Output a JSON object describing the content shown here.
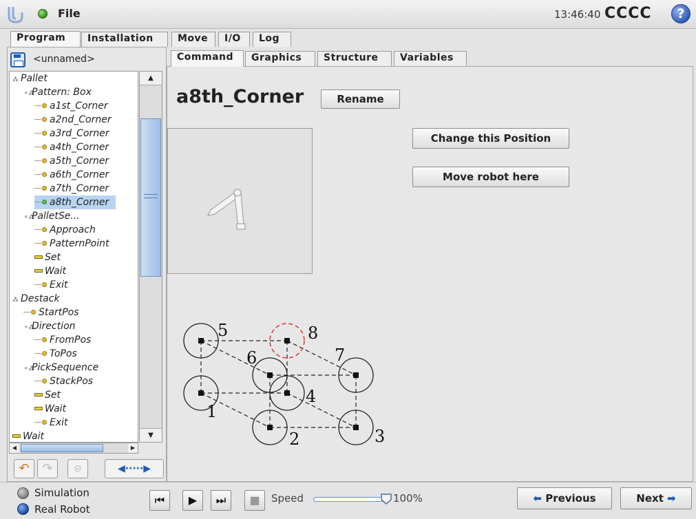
{
  "header": {
    "file_label": "File",
    "clock": "13:46:40",
    "robot_name": "CCCC",
    "help_label": "?"
  },
  "main_tabs": [
    "Program",
    "Installation",
    "Move",
    "I/O",
    "Log"
  ],
  "left": {
    "program_name": "<unnamed>",
    "tree": [
      {
        "label": "Pallet",
        "kind": "group",
        "indent": 0
      },
      {
        "label": "Pattern: Box",
        "kind": "group-expand",
        "indent": 1
      },
      {
        "label": "a1st_Corner",
        "kind": "waypoint",
        "indent": 2
      },
      {
        "label": "a2nd_Corner",
        "kind": "waypoint",
        "indent": 2
      },
      {
        "label": "a3rd_Corner",
        "kind": "waypoint",
        "indent": 2
      },
      {
        "label": "a4th_Corner",
        "kind": "waypoint",
        "indent": 2
      },
      {
        "label": "a5th_Corner",
        "kind": "waypoint",
        "indent": 2
      },
      {
        "label": "a6th_Corner",
        "kind": "waypoint",
        "indent": 2
      },
      {
        "label": "a7th_Corner",
        "kind": "waypoint",
        "indent": 2
      },
      {
        "label": "a8th_Corner",
        "kind": "waypoint-selected",
        "indent": 2
      },
      {
        "label": "PalletSe...",
        "kind": "group-expand",
        "indent": 1
      },
      {
        "label": "Approach",
        "kind": "waypoint",
        "indent": 2
      },
      {
        "label": "PatternPoint",
        "kind": "waypoint",
        "indent": 2
      },
      {
        "label": "Set",
        "kind": "action",
        "indent": 2
      },
      {
        "label": "Wait",
        "kind": "action",
        "indent": 2
      },
      {
        "label": "Exit",
        "kind": "waypoint",
        "indent": 2
      },
      {
        "label": "Destack",
        "kind": "group",
        "indent": 0
      },
      {
        "label": "StartPos",
        "kind": "waypoint",
        "indent": 1
      },
      {
        "label": "Direction",
        "kind": "group-expand",
        "indent": 1
      },
      {
        "label": "FromPos",
        "kind": "waypoint",
        "indent": 2
      },
      {
        "label": "ToPos",
        "kind": "waypoint",
        "indent": 2
      },
      {
        "label": "PickSequence",
        "kind": "group-expand",
        "indent": 1
      },
      {
        "label": "StackPos",
        "kind": "waypoint",
        "indent": 2
      },
      {
        "label": "Set",
        "kind": "action",
        "indent": 2
      },
      {
        "label": "Wait",
        "kind": "action",
        "indent": 2
      },
      {
        "label": "Exit",
        "kind": "waypoint",
        "indent": 2
      },
      {
        "label": "Wait",
        "kind": "action",
        "indent": 0
      }
    ]
  },
  "sub_tabs": [
    "Command",
    "Graphics",
    "Structure",
    "Variables"
  ],
  "command": {
    "node_name": "a8th_Corner",
    "rename_label": "Rename",
    "change_position_label": "Change this Position",
    "move_robot_label": "Move robot here",
    "diagram_numbers": [
      "1",
      "2",
      "3",
      "4",
      "5",
      "6",
      "7",
      "8"
    ]
  },
  "bottom": {
    "simulation_label": "Simulation",
    "real_robot_label": "Real Robot",
    "speed_label": "Speed",
    "speed_value": "100%",
    "speed_fraction": 1.0,
    "previous_label": "Previous",
    "next_label": "Next"
  },
  "colors": {
    "accent": "#1e5bb2",
    "selected": "#b8d4f0",
    "waypoint": "#e8b83a",
    "active_waypoint": "#60c04a",
    "highlight_circle": "#e03030"
  }
}
